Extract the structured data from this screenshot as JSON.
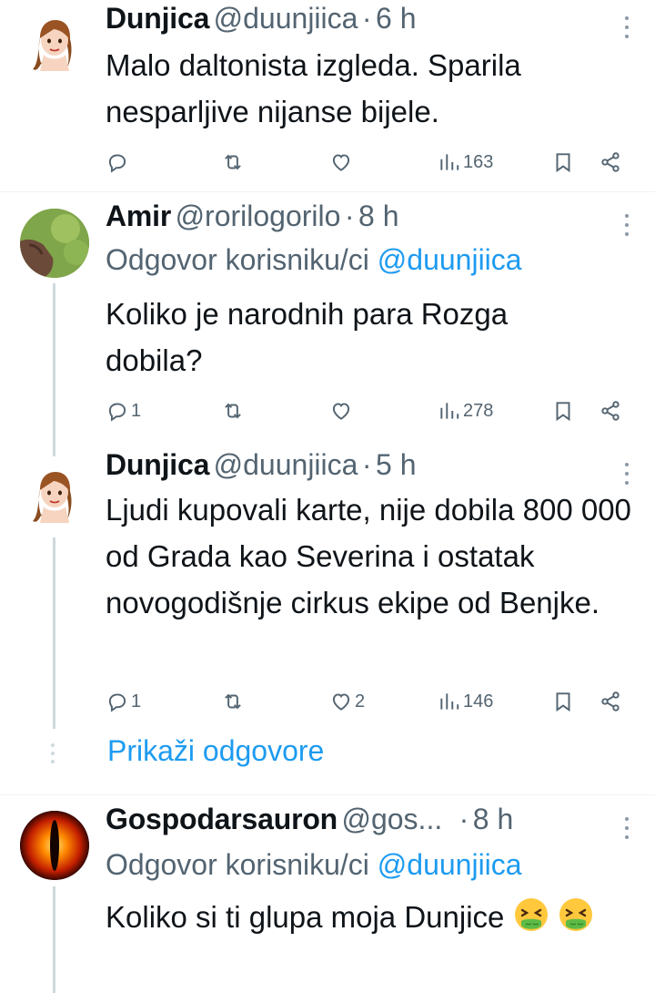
{
  "tweets": [
    {
      "name": "Dunjica",
      "handle": "@duunjiica",
      "sep": "·",
      "time": "6 h",
      "text": "Malo daltonista izgleda. Sparila nesparljive nijanse bijele.",
      "replies": "",
      "retweets": "",
      "likes": "",
      "views": "163"
    },
    {
      "name": "Amir",
      "handle": "@rorilogorilo",
      "sep": "·",
      "time": "8 h",
      "reply_prefix": "Odgovor korisniku/ci",
      "reply_mention": "@duunjiica",
      "text": "Koliko je narodnih para Rozga dobila?",
      "replies": "1",
      "retweets": "",
      "likes": "",
      "views": "278"
    },
    {
      "name": "Dunjica",
      "handle": "@duunjiica",
      "sep": "·",
      "time": "5 h",
      "text": "Ljudi kupovali karte, nije dobila 800 000 od Grada kao Severina i ostatak novogodišnje cirkus ekipe od Benjke.",
      "replies": "1",
      "retweets": "",
      "likes": "2",
      "views": "146"
    },
    {
      "name": "Gospodarsauron",
      "handle": "@gos...",
      "sep": "·",
      "time": "8 h",
      "reply_prefix": "Odgovor korisniku/ci",
      "reply_mention": "@duunjiica",
      "text": "Koliko si ti glupa moja Dunjice"
    }
  ],
  "show_replies_label": "Prikaži odgovore",
  "colors": {
    "accent": "#1d9bf0",
    "secondary_text": "#536471",
    "thread_line": "#cfd9de"
  },
  "icons": [
    "reply-icon",
    "retweet-icon",
    "like-icon",
    "views-icon",
    "bookmark-icon",
    "share-icon",
    "more-icon",
    "nauseated-face-emoji"
  ]
}
